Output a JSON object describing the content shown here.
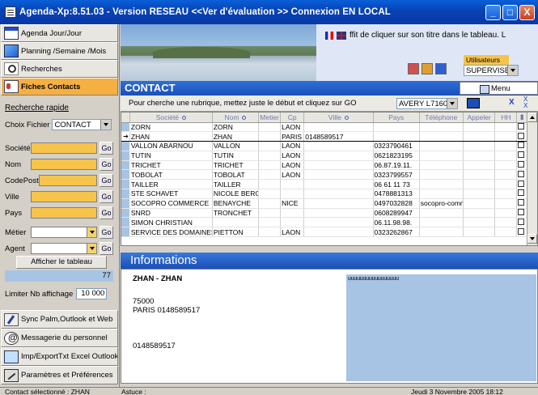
{
  "window": {
    "title": "Agenda-Xp:8.51.03 - Version RESEAU <<Ver d'évaluation >> Connexion EN LOCAL",
    "minimize": "_",
    "restore": "□",
    "close": "X"
  },
  "sidebar": {
    "nav_top": [
      {
        "label": "Agenda Jour/Jour",
        "icon": "calendar-icon"
      },
      {
        "label": "Planning /Semaine /Mois",
        "icon": "planning-icon"
      },
      {
        "label": "Recherches",
        "icon": "search-icon"
      },
      {
        "label": "Fiches Contacts",
        "icon": "contact-card-icon",
        "active": true
      }
    ],
    "quick_search": "Recherche rapide",
    "choix_label": "Choix Fichier",
    "choix_value": "CONTACT",
    "fields": {
      "societe": "Société",
      "nom": "Nom",
      "codepost": "CodePost",
      "ville": "Ville",
      "pays": "Pays",
      "metier": "Métier",
      "agent": "Agent"
    },
    "go": "Go",
    "afficher": "Afficher le tableau",
    "count": "77",
    "limit_label": "Limiter Nb affichage",
    "limit_value": "10 000",
    "nav_bottom": [
      {
        "label": "Sync Palm,Outlook et Web",
        "icon": "sync-icon"
      },
      {
        "label": "Messagerie du personnel",
        "icon": "mail-icon"
      },
      {
        "label": "Imp/ExportTxt Excel Outlook",
        "icon": "import-export-icon"
      },
      {
        "label": "Paramètres et Préférences",
        "icon": "settings-icon"
      }
    ]
  },
  "banner": {
    "text": "ffit de cliquer sur son titre dans le tableau. L",
    "users_label": "Utilisateurs",
    "users_value": "SUPERVISEUI"
  },
  "contact": {
    "title": "CONTACT",
    "menu": "Menu",
    "instruction": "Pour cherche une rubrique, mettez juste le début et cliquez sur GO",
    "label_select": "AVERY L7160",
    "close_x": "X"
  },
  "table": {
    "columns": [
      "Société",
      "Nom",
      "Metier",
      "Cp",
      "Ville",
      "Pays",
      "Téléphone",
      "Appeler",
      "HH"
    ],
    "rows": [
      {
        "societe": "ZORN",
        "nom": "ZORN",
        "metier": "",
        "cp": "LAON",
        "ville": "",
        "pays": "",
        "tel": "",
        "appeler": "",
        "current": false
      },
      {
        "societe": "ZHAN",
        "nom": "ZHAN",
        "metier": "",
        "cp": "PARIS",
        "ville": "0148589517",
        "pays": "",
        "tel": "",
        "appeler": "",
        "current": true
      },
      {
        "societe": "VALLON ABARNOU",
        "nom": "VALLON",
        "metier": "",
        "cp": "LAON",
        "ville": "",
        "pays": "0323790461",
        "tel": "",
        "appeler": "",
        "current": false
      },
      {
        "societe": "TUTIN",
        "nom": "TUTIN",
        "metier": "",
        "cp": "LAON",
        "ville": "",
        "pays": "0621823195",
        "tel": "",
        "appeler": "",
        "current": false
      },
      {
        "societe": "TRICHET",
        "nom": "TRICHET",
        "metier": "",
        "cp": "LAON",
        "ville": "",
        "pays": "06.87.19.11.",
        "tel": "",
        "appeler": "",
        "current": false
      },
      {
        "societe": "TOBOLAT",
        "nom": "TOBOLAT",
        "metier": "",
        "cp": "LAON",
        "ville": "",
        "pays": "0323799557",
        "tel": "",
        "appeler": "",
        "current": false
      },
      {
        "societe": "TAILLER",
        "nom": "TAILLER",
        "metier": "",
        "cp": "",
        "ville": "",
        "pays": "06 61 11 73",
        "tel": "",
        "appeler": "",
        "current": false
      },
      {
        "societe": "STE SCHAVET",
        "nom": "NICOLE BERGE",
        "metier": "",
        "cp": "",
        "ville": "",
        "pays": "0478881313",
        "tel": "",
        "appeler": "",
        "current": false
      },
      {
        "societe": "SOCOPRO COMMERCE",
        "nom": "BENAYCHE",
        "metier": "",
        "cp": "NICE",
        "ville": "",
        "pays": "0497032828",
        "tel": "socopro-comme",
        "appeler": "",
        "current": false
      },
      {
        "societe": "SNRD",
        "nom": "TRONCHET",
        "metier": "",
        "cp": "",
        "ville": "",
        "pays": "0608289947",
        "tel": "",
        "appeler": "",
        "current": false
      },
      {
        "societe": "SIMON CHRISTIAN",
        "nom": "",
        "metier": "",
        "cp": "",
        "ville": "",
        "pays": "06.11.98.98.",
        "tel": "",
        "appeler": "",
        "current": false
      },
      {
        "societe": "SERVICE DES DOMAINES",
        "nom": "PIETTON",
        "metier": "",
        "cp": "LAON",
        "ville": "",
        "pays": "0323262867",
        "tel": "",
        "appeler": "",
        "current": false
      }
    ]
  },
  "info": {
    "title": "Informations",
    "name": "ZHAN - ZHAN",
    "address_line1": "75000",
    "address_line2": "PARIS 0148589517",
    "phone": "0148589517",
    "notes": "uuuuuuuuuuuuuuuuu"
  },
  "status": {
    "selected": "Contact sélectionné : ZHAN",
    "tip": "Astuce :",
    "date": "Jeudi 3 Novembre 2005 18:12"
  }
}
